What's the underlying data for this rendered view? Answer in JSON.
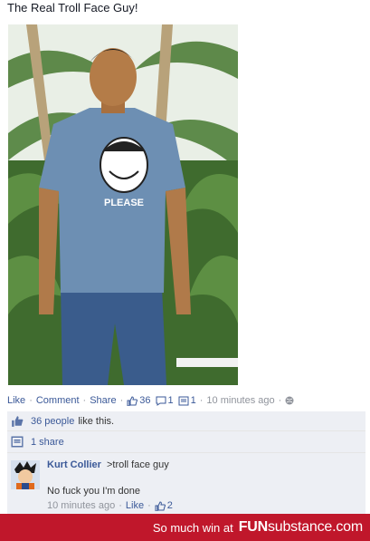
{
  "post": {
    "title": "The Real Troll Face Guy!",
    "shirt_text": "PLEASE"
  },
  "actions": {
    "like": "Like",
    "comment": "Comment",
    "share": "Share",
    "like_count": "36",
    "comment_count": "1",
    "share_count": "1",
    "timestamp": "10 minutes ago"
  },
  "ufi": {
    "likes_link": "36 people",
    "likes_suffix": "like this.",
    "shares_link": "1 share"
  },
  "comment": {
    "author": "Kurt Collier",
    "text_inline": ">troll face guy",
    "text": "No fuck you I'm done",
    "timestamp": "10 minutes ago",
    "like": "Like",
    "like_count": "2"
  },
  "footer": {
    "tagline": "So much win at",
    "logo_fun": "FUN",
    "logo_sub": "substance",
    "logo_dom": ".com"
  },
  "colors": {
    "link": "#3b5998",
    "muted": "#90949c",
    "ufi_bg": "#edeff4",
    "footer_bg": "#c0172b"
  }
}
